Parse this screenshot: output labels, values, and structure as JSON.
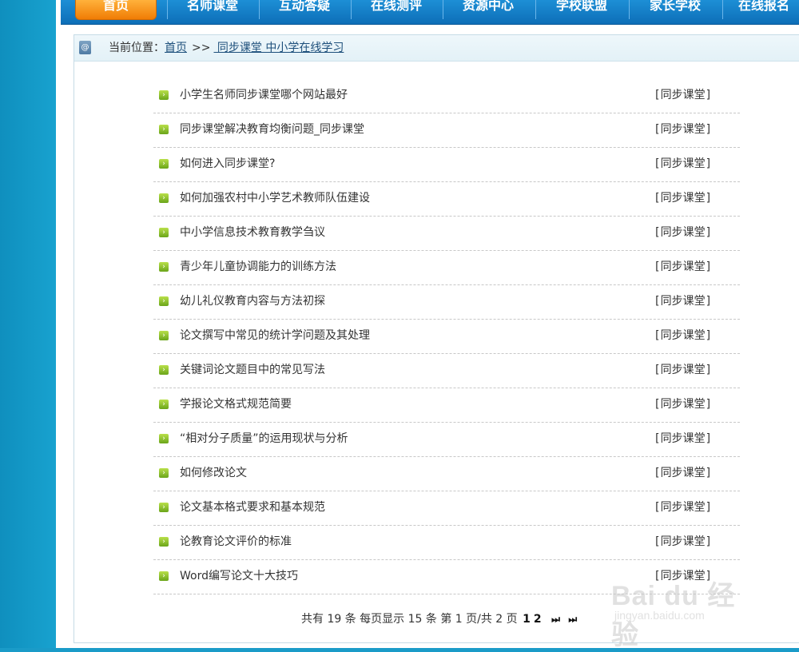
{
  "nav": {
    "items": [
      "首页",
      "名师课堂",
      "互动答疑",
      "在线测评",
      "资源中心",
      "学校联盟",
      "家长学校",
      "在线报名"
    ]
  },
  "breadcrumb": {
    "prefix": "当前位置：",
    "home": "首页",
    "separator": ">>",
    "current": " 同步课堂 中小学在线学习"
  },
  "articles": [
    {
      "title": "小学生名师同步课堂哪个网站最好",
      "category": "[同步课堂]"
    },
    {
      "title": "同步课堂解决教育均衡问题_同步课堂",
      "category": "[同步课堂]"
    },
    {
      "title": "如何进入同步课堂?",
      "category": "[同步课堂]"
    },
    {
      "title": "如何加强农村中小学艺术教师队伍建设",
      "category": "[同步课堂]"
    },
    {
      "title": "中小学信息技术教育教学刍议",
      "category": "[同步课堂]"
    },
    {
      "title": "青少年儿童协调能力的训练方法",
      "category": "[同步课堂]"
    },
    {
      "title": "幼儿礼仪教育内容与方法初探",
      "category": "[同步课堂]"
    },
    {
      "title": "论文撰写中常见的统计学问题及其处理",
      "category": "[同步课堂]"
    },
    {
      "title": "关键词论文题目中的常见写法",
      "category": "[同步课堂]"
    },
    {
      "title": "学报论文格式规范简要",
      "category": "[同步课堂]"
    },
    {
      "title": " “相对分子质量”的运用现状与分析",
      "category": "[同步课堂]"
    },
    {
      "title": "如何修改论文",
      "category": "[同步课堂]"
    },
    {
      "title": "论文基本格式要求和基本规范",
      "category": "[同步课堂]"
    },
    {
      "title": "论教育论文评价的标准",
      "category": "[同步课堂]"
    },
    {
      "title": "Word编写论文十大技巧",
      "category": "[同步课堂]"
    }
  ],
  "pager": {
    "text": "共有 19 条 每页显示 15 条 第 1 页/共 2 页",
    "pages": [
      "1",
      "2"
    ],
    "next": "⏭",
    "last": "⏭"
  },
  "watermark": {
    "logo": "Bai du 经验",
    "url": "jingyan.baidu.com"
  }
}
